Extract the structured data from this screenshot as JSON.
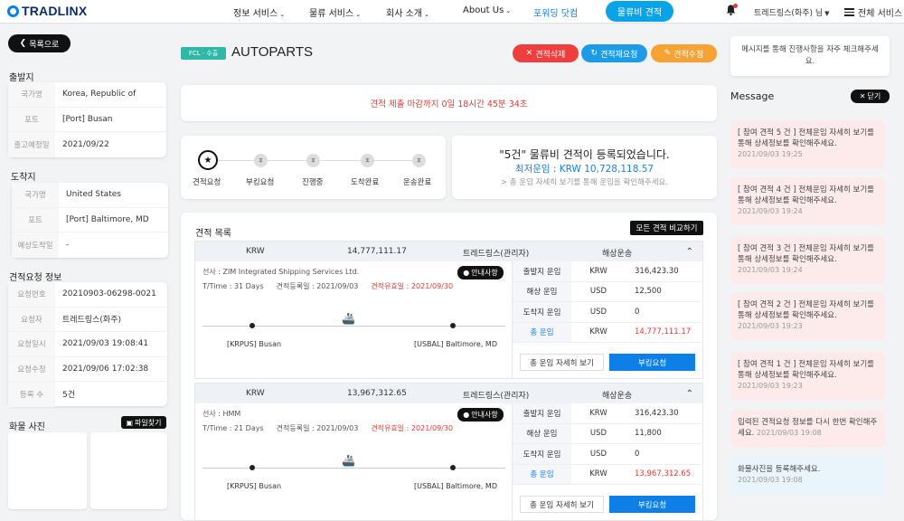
{
  "header": {
    "logo": "TRADLINX",
    "nav": [
      "정보 서비스",
      "물류 서비스",
      "회사 소개",
      "About Us",
      "포워딩 닷컴"
    ],
    "quote_button": "물류비 견적",
    "user": "트레드링스(화주) 님",
    "all_services": "전체 서비스"
  },
  "left": {
    "back_button": "목록으로",
    "origin": {
      "title": "출발지",
      "rows": [
        {
          "k": "국가명",
          "v": "Korea, Republic of"
        },
        {
          "k": "포트",
          "v": "[Port] Busan"
        },
        {
          "k": "출고예정일",
          "v": "2021/09/22"
        }
      ]
    },
    "destination": {
      "title": "도착지",
      "rows": [
        {
          "k": "국가명",
          "v": "United States"
        },
        {
          "k": "포트",
          "v": "[Port] Baltimore, MD"
        },
        {
          "k": "예상도착일",
          "v": "-"
        }
      ]
    },
    "request": {
      "title": "견적요청 정보",
      "rows": [
        {
          "k": "요청번호",
          "v": "20210903-06298-0021"
        },
        {
          "k": "요청자",
          "v": "트레드링스(화주)"
        },
        {
          "k": "요청일시",
          "v": "2021/09/03 19:08:41"
        },
        {
          "k": "요청수정",
          "v": "2021/09/06 17:02:38"
        },
        {
          "k": "등록 수",
          "v": "5건"
        }
      ]
    },
    "photos": {
      "title": "화물 사진",
      "button": "파일찾기"
    }
  },
  "center": {
    "tag": "FCL · 수출",
    "title": "AUTOPARTS",
    "actions": {
      "delete": "견적삭제",
      "rerequest": "견적재요청",
      "edit": "견적수정"
    },
    "deadline": "견적 제출 마감까지 0일 18시간 45분 34초",
    "steps": [
      "견적요청",
      "부킹요청",
      "진행중",
      "도착완료",
      "운송완료"
    ],
    "registered": {
      "title": "\"5건\" 물류비 견적이 등록되었습니다.",
      "min": "최저운임 : KRW 10,728,118.57",
      "note": "> 총 운임 자세히 보기를 통해 운임을 확인해주세요."
    },
    "list": {
      "title": "견적 목록",
      "compare_button": "모든 견적 비교하기",
      "items": [
        {
          "currency": "KRW",
          "amount": "14,777,111.17",
          "forwarder": "트레드링스(관리자)",
          "mode": "해상운송",
          "carrier": "선사 : ZIM Integrated Shipping Services Ltd.",
          "ttime": "T/Time : 31 Days",
          "reg": "견적등록일 : 2021/09/03",
          "exp": "견적유효일 : 2021/09/30",
          "guide": "안내사항",
          "from": "[KRPUS] Busan",
          "to": "[USBAL] Baltimore, MD",
          "fees": [
            {
              "label": "출발지 운임",
              "cur": "KRW",
              "val": "316,423.30"
            },
            {
              "label": "해상 운임",
              "cur": "USD",
              "val": "12,500"
            },
            {
              "label": "도착지 운임",
              "cur": "USD",
              "val": "0"
            },
            {
              "label": "총 운임",
              "cur": "KRW",
              "val": "14,777,111.17"
            }
          ],
          "detail_btn": "총 운임 자세히 보기",
          "book_btn": "부킹요청"
        },
        {
          "currency": "KRW",
          "amount": "13,967,312.65",
          "forwarder": "트레드링스(관리자)",
          "mode": "해상운송",
          "carrier": "선사 : HMM",
          "ttime": "T/Time : 21 Days",
          "reg": "견적등록일 : 2021/09/03",
          "exp": "견적유효일 : 2021/09/30",
          "guide": "안내사항",
          "from": "[KRPUS] Busan",
          "to": "[USBAL] Baltimore, MD",
          "fees": [
            {
              "label": "출발지 운임",
              "cur": "KRW",
              "val": "316,423.30"
            },
            {
              "label": "해상 운임",
              "cur": "USD",
              "val": "11,800"
            },
            {
              "label": "도착지 운임",
              "cur": "USD",
              "val": "0"
            },
            {
              "label": "총 운임",
              "cur": "KRW",
              "val": "13,967,312.65"
            }
          ],
          "detail_btn": "총 운임 자세히 보기",
          "book_btn": "부킹요청"
        }
      ]
    }
  },
  "right": {
    "note": "메시지를 통해 진행사항을 자주 체크해주세요.",
    "message_title": "Message",
    "close_button": "닫기",
    "messages": [
      {
        "text": "[ 참여 견적 5 건 ] 전체운임 자세히 보기를 통해 상세정보를 확인해주세요.",
        "date": "2021/09/03 19:25",
        "style": "pink"
      },
      {
        "text": "[ 참여 견적 4 건 ] 전체운임 자세히 보기를 통해 상세정보를 확인해주세요.",
        "date": "2021/09/03 19:24",
        "style": "pink"
      },
      {
        "text": "[ 참여 견적 3 건 ] 전체운임 자세히 보기를 통해 상세정보를 확인해주세요.",
        "date": "2021/09/03 19:24",
        "style": "pink"
      },
      {
        "text": "[ 참여 견적 2 건 ] 전체운임 자세히 보기를 통해 상세정보를 확인해주세요.",
        "date": "2021/09/03 19:23",
        "style": "pink"
      },
      {
        "text": "[ 참여 견적 1 건 ] 전체운임 자세히 보기를 통해 상세정보를 확인해주세요.",
        "date": "2021/09/03 19:23",
        "style": "pink"
      },
      {
        "text": "입력된 견적요청 정보를 다시 한번 확인해주세요.",
        "date": "2021/09/03 19:08",
        "style": "pink"
      },
      {
        "text": "화물사진을 등록해주세요.",
        "date": "2021/09/03 19:08",
        "style": "blue"
      }
    ]
  },
  "colors": {
    "accent": "#0d7fe6",
    "danger": "#e53935",
    "teal": "#2fb8a6",
    "orange": "#f7a234"
  }
}
